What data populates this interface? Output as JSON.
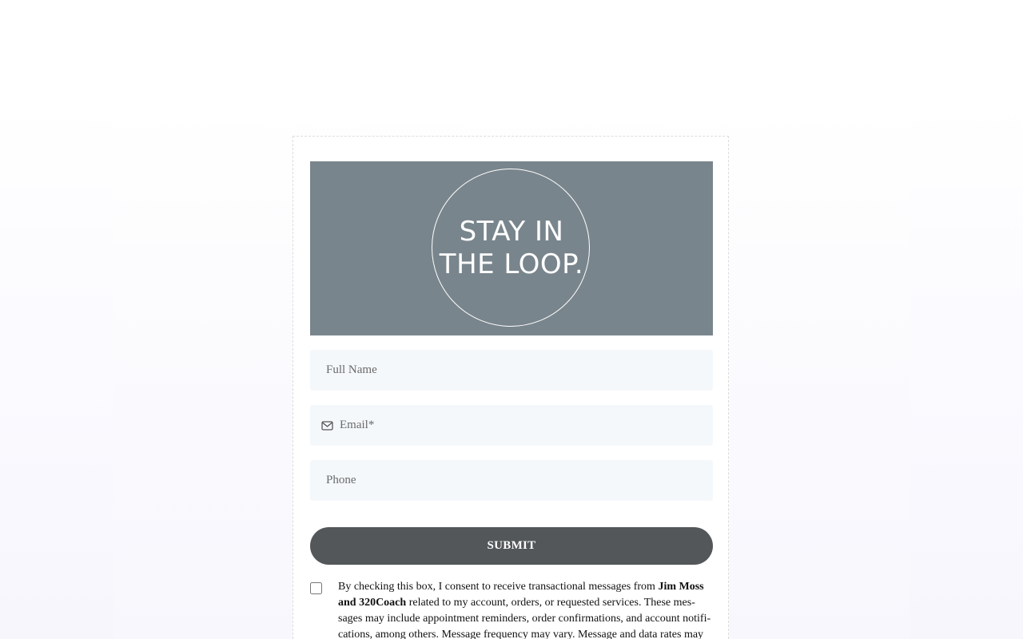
{
  "banner": {
    "line1": "STAY IN",
    "line2": "THE LOOP.",
    "background_color": "#79858c"
  },
  "form": {
    "full_name_placeholder": "Full Name",
    "email_placeholder": "Email*",
    "email_icon": "envelope-icon",
    "phone_placeholder": "Phone",
    "submit_label": "SUBMIT",
    "submit_color": "#535759"
  },
  "consent": {
    "checked": false,
    "text_before": "By checking this box, I consent to receive transactional messages from ",
    "company": "Jim Moss and 320Coach",
    "text_after": " related to my account, orders, or requested services. These mes­sages may include appointment reminders, order confirmations, and account notifi­cations, among others. Message frequency may vary. Message and data rates may"
  }
}
